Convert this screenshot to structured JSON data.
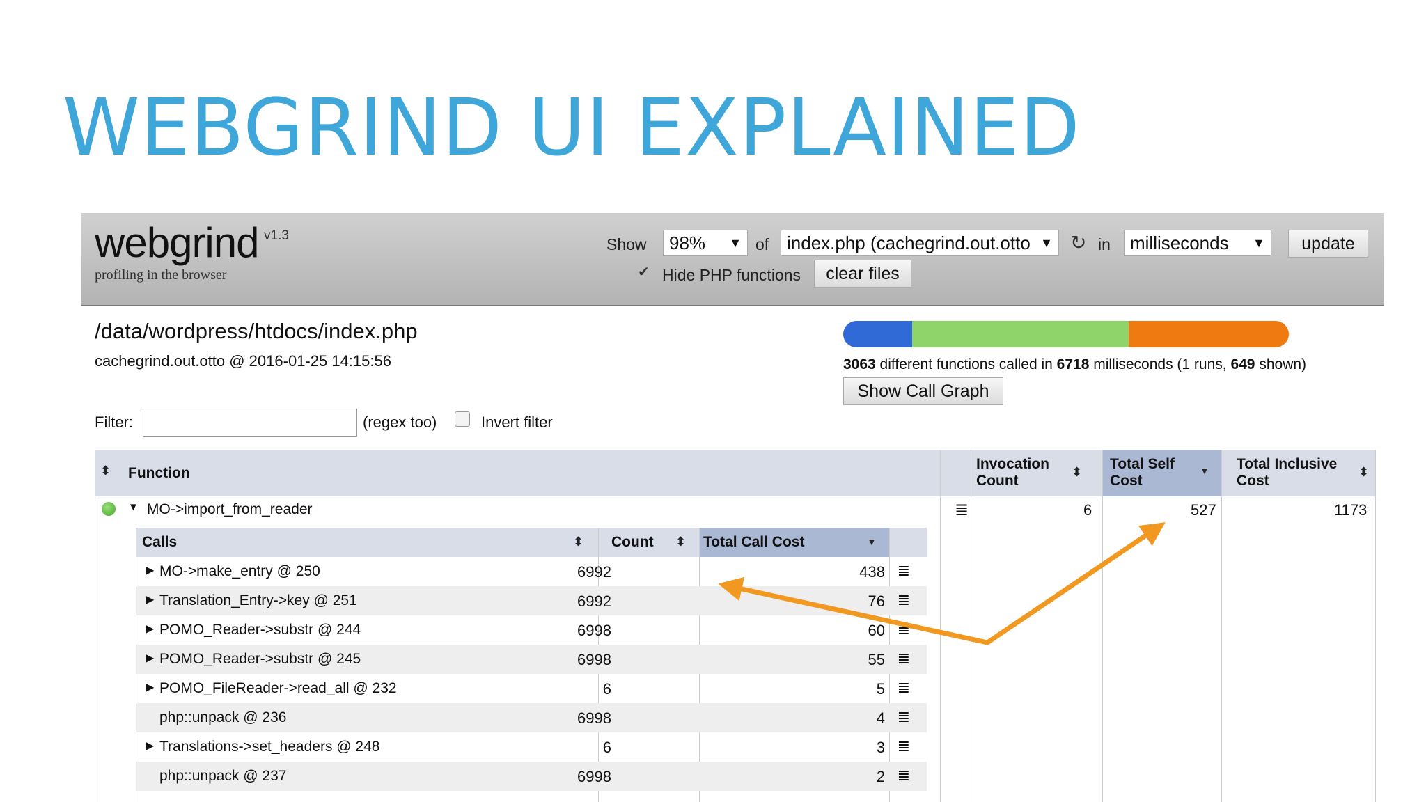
{
  "slide": {
    "title": "WEBGRIND UI EXPLAINED"
  },
  "app": {
    "logo": "webgrind",
    "version": "v1.3",
    "tagline": "profiling in the browser"
  },
  "toolbar": {
    "show_label": "Show",
    "show_value": "98%",
    "of_label": "of",
    "file_value": "index.php (cachegrind.out.otto",
    "in_label": "in",
    "unit_value": "milliseconds",
    "update_label": "update",
    "hide_php_checked": true,
    "hide_php_label": "Hide PHP functions",
    "clear_files_label": "clear files"
  },
  "info": {
    "path": "/data/wordpress/htdocs/index.php",
    "meta": "cachegrind.out.otto @ 2016-01-25 14:15:56",
    "summary": {
      "functions": "3063",
      "text1": " different functions called in ",
      "ms": "6718",
      "text2": " milliseconds (1 runs, ",
      "shown": "649",
      "text3": " shown)"
    },
    "call_graph_label": "Show Call Graph",
    "progress": [
      {
        "fraction": 0.155,
        "color": "#2f6ad6"
      },
      {
        "fraction": 0.485,
        "color": "#8fd46a"
      },
      {
        "fraction": 0.36,
        "color": "#f07a12"
      }
    ]
  },
  "filter": {
    "label": "Filter:",
    "value": "",
    "regex_note": "(regex too)",
    "invert_label": "Invert filter"
  },
  "table": {
    "headers": {
      "function": "Function",
      "invocation_line1": "Invocation",
      "invocation_line2": "Count",
      "self_line1": "Total Self",
      "self_line2": "Cost",
      "inclusive_line1": "Total Inclusive",
      "inclusive_line2": "Cost"
    },
    "row": {
      "function": "MO->import_from_reader",
      "invocation_count": "6",
      "self_cost": "527",
      "inclusive_cost": "1173"
    }
  },
  "calls": {
    "headers": {
      "calls": "Calls",
      "count": "Count",
      "total_call_cost": "Total Call Cost"
    },
    "rows": [
      {
        "name": "MO->make_entry @ 250",
        "count": "6992",
        "cost": "438",
        "expandable": true
      },
      {
        "name": "Translation_Entry->key @ 251",
        "count": "6992",
        "cost": "76",
        "expandable": true
      },
      {
        "name": "POMO_Reader->substr @ 244",
        "count": "6998",
        "cost": "60",
        "expandable": true
      },
      {
        "name": "POMO_Reader->substr @ 245",
        "count": "6998",
        "cost": "55",
        "expandable": true
      },
      {
        "name": "POMO_FileReader->read_all @ 232",
        "count": "6",
        "cost": "5",
        "expandable": true
      },
      {
        "name": "php::unpack @ 236",
        "count": "6998",
        "cost": "4",
        "expandable": false
      },
      {
        "name": "Translations->set_headers @ 248",
        "count": "6",
        "cost": "3",
        "expandable": true
      },
      {
        "name": "php::unpack @ 237",
        "count": "6998",
        "cost": "2",
        "expandable": false
      }
    ]
  },
  "colors": {
    "title": "#3ea6d8",
    "arrow": "#f0981f"
  }
}
